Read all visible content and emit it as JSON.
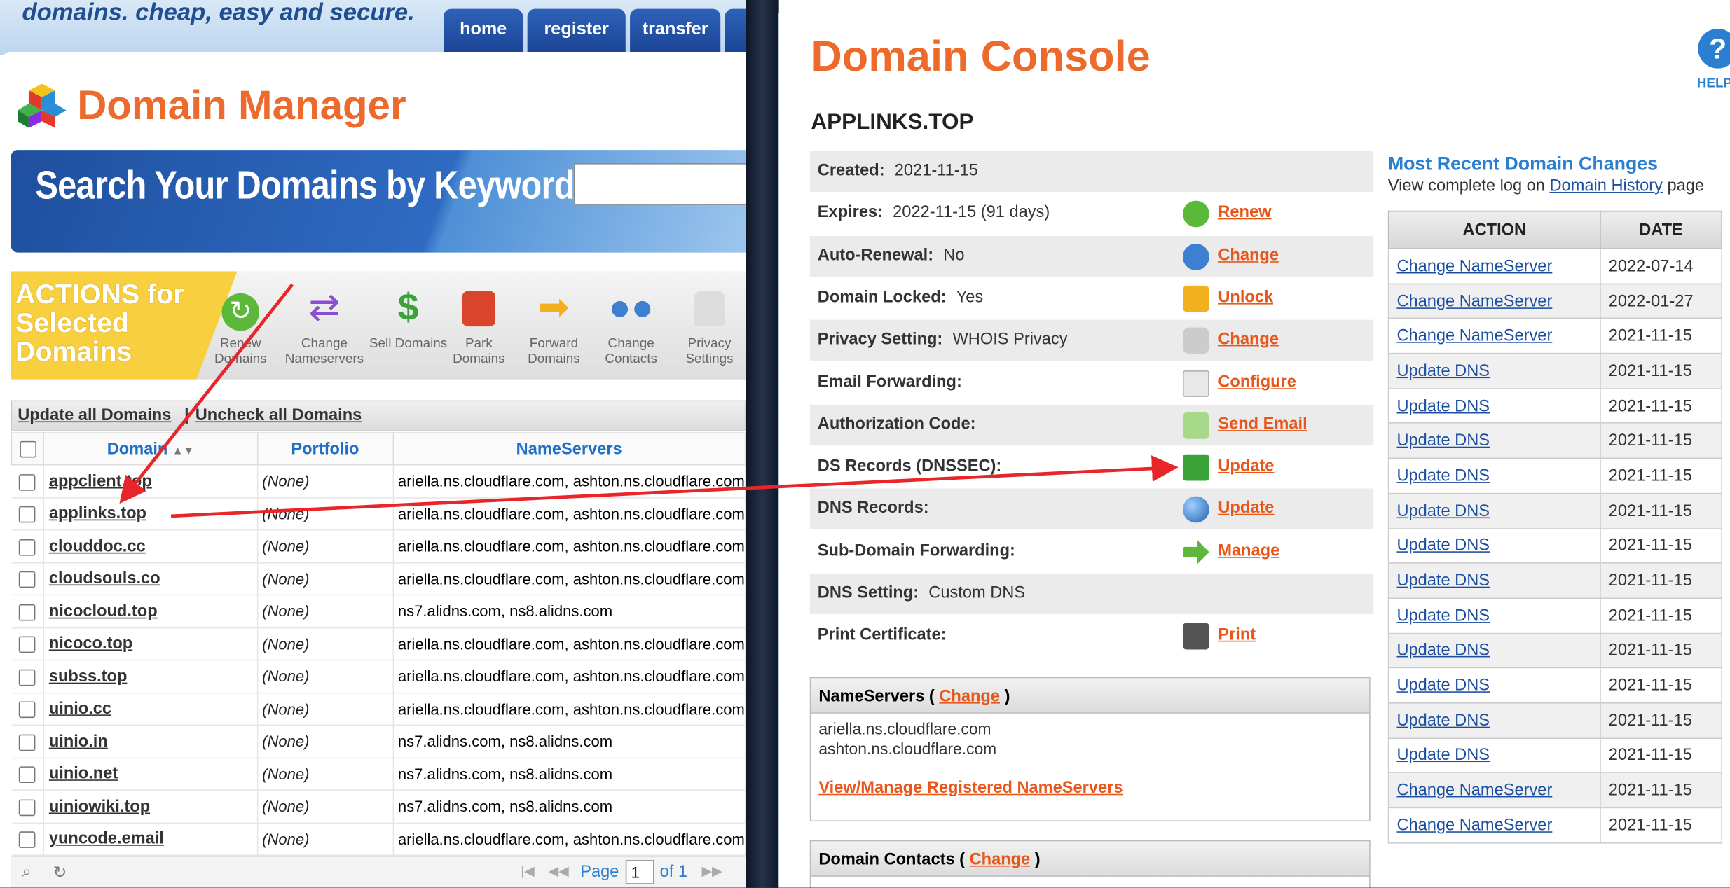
{
  "manager": {
    "tagline": "domains. cheap, easy and secure.",
    "nav": [
      "home",
      "register",
      "transfer"
    ],
    "title": "Domain Manager",
    "search_banner": "Search Your Domains by Keyword",
    "actions_label": "ACTIONS for Selected Domains",
    "actions": [
      {
        "icon": "renew-icon",
        "label": "Renew Domains"
      },
      {
        "icon": "change-nameservers-icon",
        "label": "Change Nameservers"
      },
      {
        "icon": "dollar-icon",
        "label": "Sell Domains"
      },
      {
        "icon": "bus-icon",
        "label": "Park Domains"
      },
      {
        "icon": "forward-arrow-icon",
        "label": "Forward Domains"
      },
      {
        "icon": "contacts-icon",
        "label": "Change Contacts"
      },
      {
        "icon": "privacy-icon",
        "label": "Privacy Settings"
      }
    ],
    "toolbar": {
      "update_all": "Update all Domains",
      "separator": "|",
      "uncheck_all": "Uncheck all Domains"
    },
    "columns": {
      "domain": "Domain",
      "portfolio": "Portfolio",
      "nameservers": "NameServers"
    },
    "rows": [
      {
        "domain": "appclient.top",
        "portfolio": "(None)",
        "ns": "ariella.ns.cloudflare.com, ashton.ns.cloudflare.com"
      },
      {
        "domain": "applinks.top",
        "portfolio": "(None)",
        "ns": "ariella.ns.cloudflare.com, ashton.ns.cloudflare.com"
      },
      {
        "domain": "clouddoc.cc",
        "portfolio": "(None)",
        "ns": "ariella.ns.cloudflare.com, ashton.ns.cloudflare.com"
      },
      {
        "domain": "cloudsouls.co",
        "portfolio": "(None)",
        "ns": "ariella.ns.cloudflare.com, ashton.ns.cloudflare.com"
      },
      {
        "domain": "nicocloud.top",
        "portfolio": "(None)",
        "ns": "ns7.alidns.com, ns8.alidns.com"
      },
      {
        "domain": "nicoco.top",
        "portfolio": "(None)",
        "ns": "ariella.ns.cloudflare.com, ashton.ns.cloudflare.com"
      },
      {
        "domain": "subss.top",
        "portfolio": "(None)",
        "ns": "ariella.ns.cloudflare.com, ashton.ns.cloudflare.com"
      },
      {
        "domain": "uinio.cc",
        "portfolio": "(None)",
        "ns": "ariella.ns.cloudflare.com, ashton.ns.cloudflare.com"
      },
      {
        "domain": "uinio.in",
        "portfolio": "(None)",
        "ns": "ns7.alidns.com, ns8.alidns.com"
      },
      {
        "domain": "uinio.net",
        "portfolio": "(None)",
        "ns": "ns7.alidns.com, ns8.alidns.com"
      },
      {
        "domain": "uiniowiki.top",
        "portfolio": "(None)",
        "ns": "ns7.alidns.com, ns8.alidns.com"
      },
      {
        "domain": "yuncode.email",
        "portfolio": "(None)",
        "ns": "ariella.ns.cloudflare.com, ashton.ns.cloudflare.com"
      }
    ],
    "pager": {
      "page_label": "Page",
      "page_value": "1",
      "of_label": "of 1"
    }
  },
  "console": {
    "title": "Domain Console",
    "help": "?",
    "help_label": "HELP",
    "domain": "APPLINKS.TOP",
    "info": [
      {
        "label": "Created:",
        "value": "2021-11-15",
        "action": "",
        "icon": ""
      },
      {
        "label": "Expires:",
        "value": "2022-11-15 (91 days)",
        "action": "Renew",
        "icon": "renew-icon"
      },
      {
        "label": "Auto-Renewal:",
        "value": "No",
        "action": "Change",
        "icon": "clock-icon"
      },
      {
        "label": "Domain Locked:",
        "value": "Yes",
        "action": "Unlock",
        "icon": "padlock-icon"
      },
      {
        "label": "Privacy Setting:",
        "value": "WHOIS Privacy",
        "action": "Change",
        "icon": "privacy-icon"
      },
      {
        "label": "Email Forwarding:",
        "value": "",
        "action": "Configure",
        "icon": "envelope-icon"
      },
      {
        "label": "Authorization Code:",
        "value": "",
        "action": "Send Email",
        "icon": "send-email-icon"
      },
      {
        "label": "DS Records (DNSSEC):",
        "value": "",
        "action": "Update",
        "icon": "key-icon"
      },
      {
        "label": "DNS Records:",
        "value": "",
        "action": "Update",
        "icon": "globe-icon"
      },
      {
        "label": "Sub-Domain Forwarding:",
        "value": "",
        "action": "Manage",
        "icon": "forward-arrow-icon"
      },
      {
        "label": "DNS Setting:",
        "value": "Custom DNS",
        "action": "",
        "icon": ""
      },
      {
        "label": "Print Certificate:",
        "value": "",
        "action": "Print",
        "icon": "printer-icon"
      }
    ],
    "nameservers": {
      "heading_prefix": "NameServers (",
      "heading_link": "Change",
      "heading_suffix": ")",
      "list": [
        "ariella.ns.cloudflare.com",
        "ashton.ns.cloudflare.com"
      ],
      "manage_link": "View/Manage Registered NameServers"
    },
    "contacts": {
      "heading_prefix": "Domain Contacts (",
      "heading_link": "Change",
      "heading_suffix": ")"
    },
    "recent": {
      "title": "Most Recent Domain Changes",
      "sub_prefix": "View complete log on",
      "sub_link": "Domain History",
      "sub_suffix": "page",
      "columns": [
        "ACTION",
        "DATE"
      ],
      "rows": [
        [
          "Change NameServer",
          "2022-07-14"
        ],
        [
          "Change NameServer",
          "2022-01-27"
        ],
        [
          "Change NameServer",
          "2021-11-15"
        ],
        [
          "Update DNS",
          "2021-11-15"
        ],
        [
          "Update DNS",
          "2021-11-15"
        ],
        [
          "Update DNS",
          "2021-11-15"
        ],
        [
          "Update DNS",
          "2021-11-15"
        ],
        [
          "Update DNS",
          "2021-11-15"
        ],
        [
          "Update DNS",
          "2021-11-15"
        ],
        [
          "Update DNS",
          "2021-11-15"
        ],
        [
          "Update DNS",
          "2021-11-15"
        ],
        [
          "Update DNS",
          "2021-11-15"
        ],
        [
          "Update DNS",
          "2021-11-15"
        ],
        [
          "Update DNS",
          "2021-11-15"
        ],
        [
          "Update DNS",
          "2021-11-15"
        ],
        [
          "Change NameServer",
          "2021-11-15"
        ],
        [
          "Change NameServer",
          "2021-11-15"
        ]
      ]
    }
  },
  "colors": {
    "orange": "#ec6a2c",
    "blue": "#2a7fd1",
    "arrow": "#e8262a"
  }
}
